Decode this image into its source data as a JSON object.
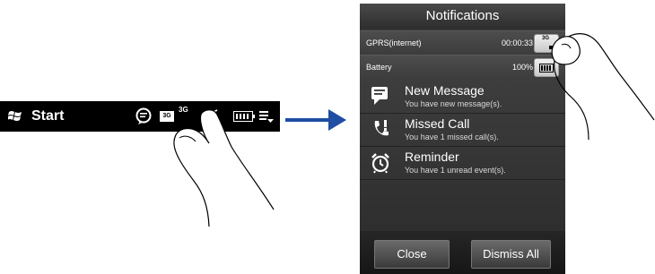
{
  "taskbar": {
    "start_label": "Start",
    "status_3g": "3G",
    "status_3g_top": "3G"
  },
  "panel": {
    "title": "Notifications",
    "status_rows": [
      {
        "label": "GPRS(internet)",
        "value": "00:00:33",
        "button_text": "3G"
      },
      {
        "label": "Battery",
        "value": "100%"
      }
    ],
    "notifications": [
      {
        "title": "New Message",
        "subtitle": "You have new message(s).",
        "icon": "message-icon"
      },
      {
        "title": "Missed Call",
        "subtitle": "You have 1 missed call(s).",
        "icon": "missed-call-icon"
      },
      {
        "title": "Reminder",
        "subtitle": "You have 1 unread event(s).",
        "icon": "alarm-clock-icon"
      }
    ],
    "buttons": {
      "close": "Close",
      "dismiss_all": "Dismiss All"
    }
  },
  "colors": {
    "arrow": "#1f4ea3",
    "panel_bg": "#353535",
    "taskbar_bg": "#000000"
  }
}
